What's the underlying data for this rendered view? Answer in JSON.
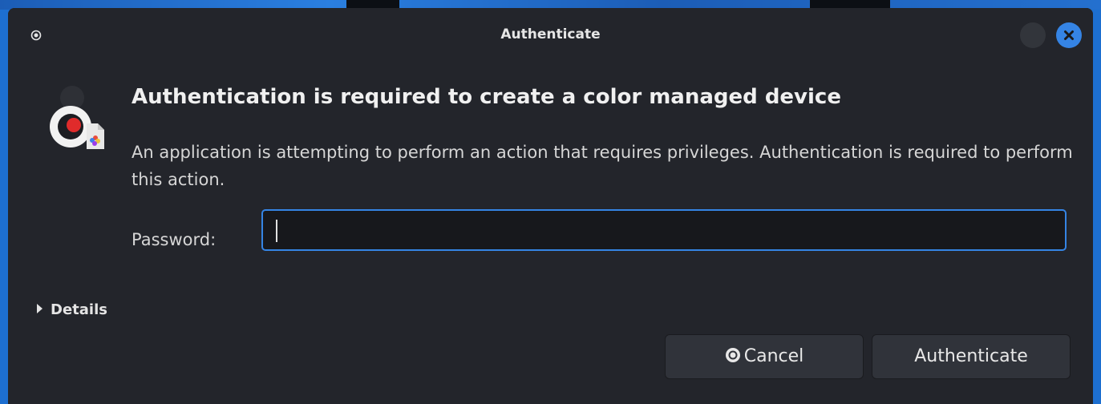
{
  "window": {
    "title": "Authenticate"
  },
  "dialog": {
    "heading": "Authentication is required to create a color managed device",
    "description": "An application is attempting to perform an action that requires privileges. Authentication is required to perform this action.",
    "password_label": "Password:",
    "password_value": "",
    "details_label": "Details",
    "cancel_label": "Cancel",
    "authenticate_label": "Authenticate"
  },
  "icons": {
    "app_menu": "record-icon",
    "app": "color-device-icon",
    "minimize": "minimize-icon",
    "close": "close-icon",
    "details_toggle": "triangle-right-icon",
    "cancel": "stop-icon"
  },
  "colors": {
    "accent": "#3584e4",
    "window_bg": "#23252b",
    "input_bg": "#17181c",
    "button_bg": "#30333a"
  }
}
